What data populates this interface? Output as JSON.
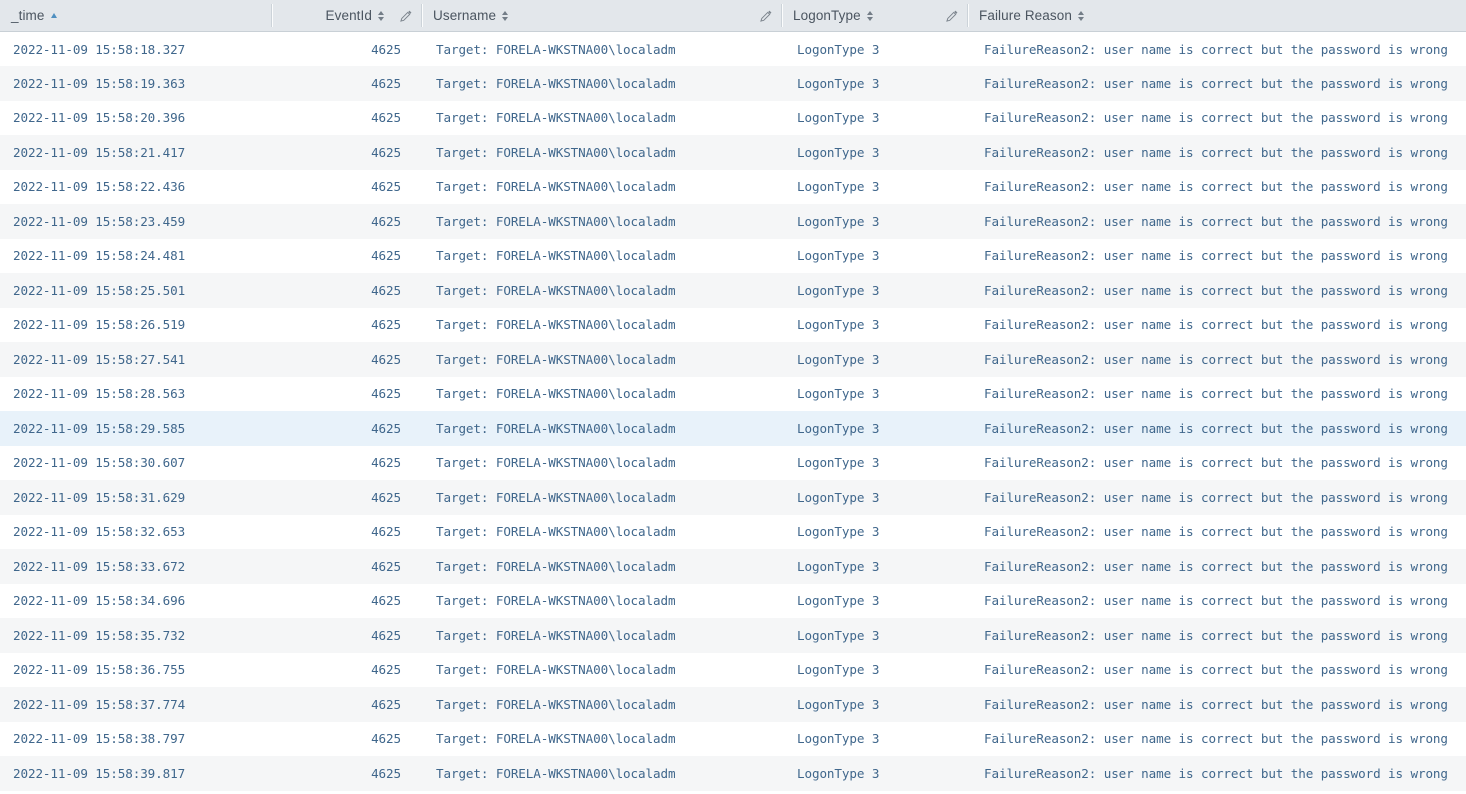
{
  "table": {
    "columns": [
      {
        "key": "time",
        "label": "_time",
        "sort": "asc",
        "editable": false,
        "align": "left"
      },
      {
        "key": "event",
        "label": "EventId",
        "sort": "neutral",
        "editable": true,
        "align": "right"
      },
      {
        "key": "user",
        "label": "Username",
        "sort": "neutral",
        "editable": true,
        "align": "left"
      },
      {
        "key": "ltype",
        "label": "LogonType",
        "sort": "neutral",
        "editable": true,
        "align": "left"
      },
      {
        "key": "reason",
        "label": "Failure Reason",
        "sort": "neutral",
        "editable": false,
        "align": "left"
      }
    ],
    "icons": {
      "sort": "sort-arrows-icon",
      "sort_active": "sort-ascending-icon",
      "edit": "pencil-icon"
    },
    "highlighted_row_index": 11,
    "rows": [
      {
        "time": "2022-11-09 15:58:18.327",
        "event": "4625",
        "user": "Target: FORELA-WKSTNA00\\localadm",
        "ltype": "LogonType 3",
        "reason": "FailureReason2: user name is correct but the password is wrong"
      },
      {
        "time": "2022-11-09 15:58:19.363",
        "event": "4625",
        "user": "Target: FORELA-WKSTNA00\\localadm",
        "ltype": "LogonType 3",
        "reason": "FailureReason2: user name is correct but the password is wrong"
      },
      {
        "time": "2022-11-09 15:58:20.396",
        "event": "4625",
        "user": "Target: FORELA-WKSTNA00\\localadm",
        "ltype": "LogonType 3",
        "reason": "FailureReason2: user name is correct but the password is wrong"
      },
      {
        "time": "2022-11-09 15:58:21.417",
        "event": "4625",
        "user": "Target: FORELA-WKSTNA00\\localadm",
        "ltype": "LogonType 3",
        "reason": "FailureReason2: user name is correct but the password is wrong"
      },
      {
        "time": "2022-11-09 15:58:22.436",
        "event": "4625",
        "user": "Target: FORELA-WKSTNA00\\localadm",
        "ltype": "LogonType 3",
        "reason": "FailureReason2: user name is correct but the password is wrong"
      },
      {
        "time": "2022-11-09 15:58:23.459",
        "event": "4625",
        "user": "Target: FORELA-WKSTNA00\\localadm",
        "ltype": "LogonType 3",
        "reason": "FailureReason2: user name is correct but the password is wrong"
      },
      {
        "time": "2022-11-09 15:58:24.481",
        "event": "4625",
        "user": "Target: FORELA-WKSTNA00\\localadm",
        "ltype": "LogonType 3",
        "reason": "FailureReason2: user name is correct but the password is wrong"
      },
      {
        "time": "2022-11-09 15:58:25.501",
        "event": "4625",
        "user": "Target: FORELA-WKSTNA00\\localadm",
        "ltype": "LogonType 3",
        "reason": "FailureReason2: user name is correct but the password is wrong"
      },
      {
        "time": "2022-11-09 15:58:26.519",
        "event": "4625",
        "user": "Target: FORELA-WKSTNA00\\localadm",
        "ltype": "LogonType 3",
        "reason": "FailureReason2: user name is correct but the password is wrong"
      },
      {
        "time": "2022-11-09 15:58:27.541",
        "event": "4625",
        "user": "Target: FORELA-WKSTNA00\\localadm",
        "ltype": "LogonType 3",
        "reason": "FailureReason2: user name is correct but the password is wrong"
      },
      {
        "time": "2022-11-09 15:58:28.563",
        "event": "4625",
        "user": "Target: FORELA-WKSTNA00\\localadm",
        "ltype": "LogonType 3",
        "reason": "FailureReason2: user name is correct but the password is wrong"
      },
      {
        "time": "2022-11-09 15:58:29.585",
        "event": "4625",
        "user": "Target: FORELA-WKSTNA00\\localadm",
        "ltype": "LogonType 3",
        "reason": "FailureReason2: user name is correct but the password is wrong"
      },
      {
        "time": "2022-11-09 15:58:30.607",
        "event": "4625",
        "user": "Target: FORELA-WKSTNA00\\localadm",
        "ltype": "LogonType 3",
        "reason": "FailureReason2: user name is correct but the password is wrong"
      },
      {
        "time": "2022-11-09 15:58:31.629",
        "event": "4625",
        "user": "Target: FORELA-WKSTNA00\\localadm",
        "ltype": "LogonType 3",
        "reason": "FailureReason2: user name is correct but the password is wrong"
      },
      {
        "time": "2022-11-09 15:58:32.653",
        "event": "4625",
        "user": "Target: FORELA-WKSTNA00\\localadm",
        "ltype": "LogonType 3",
        "reason": "FailureReason2: user name is correct but the password is wrong"
      },
      {
        "time": "2022-11-09 15:58:33.672",
        "event": "4625",
        "user": "Target: FORELA-WKSTNA00\\localadm",
        "ltype": "LogonType 3",
        "reason": "FailureReason2: user name is correct but the password is wrong"
      },
      {
        "time": "2022-11-09 15:58:34.696",
        "event": "4625",
        "user": "Target: FORELA-WKSTNA00\\localadm",
        "ltype": "LogonType 3",
        "reason": "FailureReason2: user name is correct but the password is wrong"
      },
      {
        "time": "2022-11-09 15:58:35.732",
        "event": "4625",
        "user": "Target: FORELA-WKSTNA00\\localadm",
        "ltype": "LogonType 3",
        "reason": "FailureReason2: user name is correct but the password is wrong"
      },
      {
        "time": "2022-11-09 15:58:36.755",
        "event": "4625",
        "user": "Target: FORELA-WKSTNA00\\localadm",
        "ltype": "LogonType 3",
        "reason": "FailureReason2: user name is correct but the password is wrong"
      },
      {
        "time": "2022-11-09 15:58:37.774",
        "event": "4625",
        "user": "Target: FORELA-WKSTNA00\\localadm",
        "ltype": "LogonType 3",
        "reason": "FailureReason2: user name is correct but the password is wrong"
      },
      {
        "time": "2022-11-09 15:58:38.797",
        "event": "4625",
        "user": "Target: FORELA-WKSTNA00\\localadm",
        "ltype": "LogonType 3",
        "reason": "FailureReason2: user name is correct but the password is wrong"
      },
      {
        "time": "2022-11-09 15:58:39.817",
        "event": "4625",
        "user": "Target: FORELA-WKSTNA00\\localadm",
        "ltype": "LogonType 3",
        "reason": "FailureReason2: user name is correct but the password is wrong"
      }
    ]
  },
  "colors": {
    "header_bg": "#e3e7eb",
    "row_even_bg": "#f5f6f7",
    "row_odd_bg": "#ffffff",
    "row_highlight_bg": "#e8f2fa",
    "cell_text": "#40678c",
    "header_text": "#4b5560",
    "sort_active": "#4f8fc0"
  }
}
